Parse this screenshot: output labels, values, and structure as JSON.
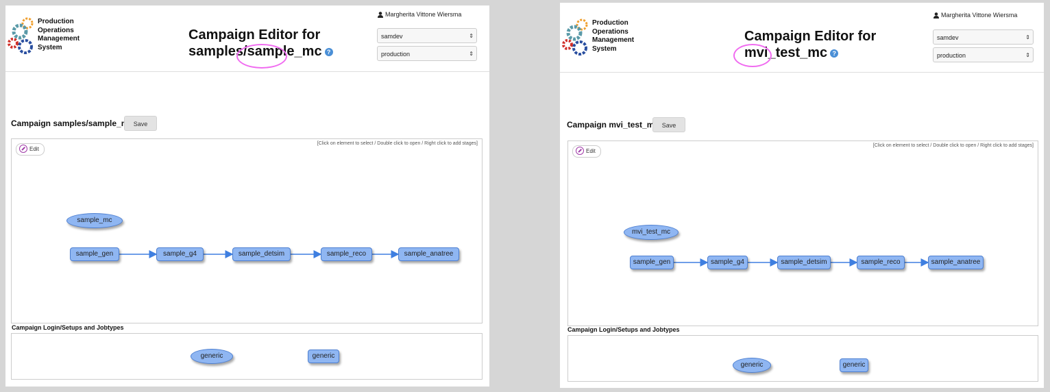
{
  "logo": {
    "lines": [
      "Production",
      "Operations",
      "Management",
      "System"
    ]
  },
  "left": {
    "title_line1": "Campaign Editor for",
    "title_line2": "samples/sample_mc",
    "user": "Margherita Vittone Wiersma",
    "experiment_select": "samdev",
    "role_select": "production",
    "campaign_label": "Campaign samples/sample_mc",
    "save_label": "Save",
    "hint": "[Click on element to select / Double click to open / Right click to add stages]",
    "edit_label": "Edit",
    "campaign_node": "sample_mc",
    "stages": [
      "sample_gen",
      "sample_g4",
      "sample_detsim",
      "sample_reco",
      "sample_anatree"
    ],
    "setups_label": "Campaign Login/Setups and Jobtypes",
    "login_node": "generic",
    "jobtype_node": "generic"
  },
  "right": {
    "title_line1": "Campaign Editor for",
    "title_line2": "mvi_test_mc",
    "user": "Margherita Vittone Wiersma",
    "experiment_select": "samdev",
    "role_select": "production",
    "campaign_label": "Campaign mvi_test_mc",
    "save_label": "Save",
    "hint": "[Click on element to select / Double click to open / Right click to add stages]",
    "edit_label": "Edit",
    "campaign_node": "mvi_test_mc",
    "stages": [
      "sample_gen",
      "sample_g4",
      "sample_detsim",
      "sample_reco",
      "sample_anatree"
    ],
    "setups_label": "Campaign Login/Setups and Jobtypes",
    "login_node": "generic",
    "jobtype_node": "generic"
  },
  "icons": {
    "help": "?",
    "select_arrows": "⇕",
    "user": "user-icon",
    "pencil": "pencil-icon",
    "gears": "gears-logo"
  },
  "colors": {
    "node_fill": "#8fb6f2",
    "node_border": "#4d7fd1",
    "edge": "#3f7fe0",
    "highlight": "#f06bf0",
    "gear_orange": "#f0a030",
    "gear_teal": "#5a9aa8",
    "gear_red": "#d0302a",
    "gear_blue": "#2a4fa0"
  }
}
